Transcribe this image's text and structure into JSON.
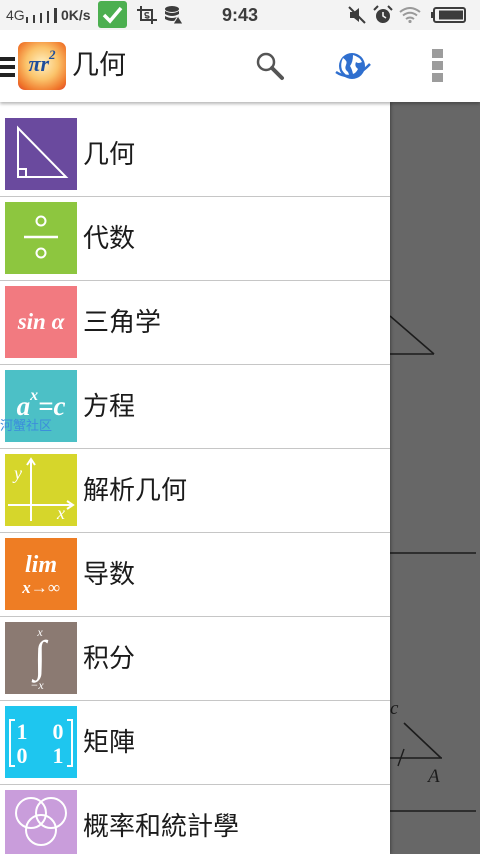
{
  "status_bar": {
    "network": "4G",
    "speed": "0K/s",
    "time": "9:43",
    "check_color": "#4caf50",
    "icons": [
      "signal-icon",
      "check-icon",
      "crop-icon",
      "database-icon",
      "mute-icon",
      "alarm-icon",
      "wifi-icon",
      "battery-icon"
    ]
  },
  "app_bar": {
    "logo": {
      "base": "πr",
      "sup": "2"
    },
    "title": "几何",
    "icons": [
      "menu-icon",
      "search-icon",
      "globe-icon",
      "overflow-icon"
    ],
    "globe_color": "#2f6fcf"
  },
  "drawer": {
    "items": [
      {
        "label": "几何",
        "color": "#6a4a9e",
        "icon": "right-triangle-icon"
      },
      {
        "label": "代数",
        "color": "#8dc63f",
        "icon": "divide-icon"
      },
      {
        "label": "三角学",
        "color": "#f27a80",
        "icon": "sine-icon",
        "icon_text": "sin α"
      },
      {
        "label": "方程",
        "color": "#4cc0c6",
        "icon": "exponent-equation-icon",
        "icon_text": {
          "base": "a",
          "sup": "x",
          "rest": "=c"
        }
      },
      {
        "label": "解析几何",
        "color": "#d6d62b",
        "icon": "axes-icon",
        "icon_text": {
          "y": "y",
          "x": "x"
        }
      },
      {
        "label": "导数",
        "color": "#ee7d24",
        "icon": "limit-icon",
        "icon_text": {
          "top": "lim",
          "bottom": "x→∞"
        }
      },
      {
        "label": "积分",
        "color": "#8b7a72",
        "icon": "integral-icon",
        "icon_text": {
          "upper": "x",
          "symbol": "∫",
          "lower": "−x"
        }
      },
      {
        "label": "矩陣",
        "color": "#1ec6ef",
        "icon": "matrix-icon",
        "icon_text": [
          "1",
          "0",
          "0",
          "1"
        ]
      },
      {
        "label": "概率和統計學",
        "color": "#c99ddb",
        "icon": "venn-diagram-icon"
      }
    ]
  },
  "watermark": "河蟹社区",
  "background_content": {
    "labels": [
      "c",
      "A"
    ]
  },
  "scrim_color": "#676767"
}
